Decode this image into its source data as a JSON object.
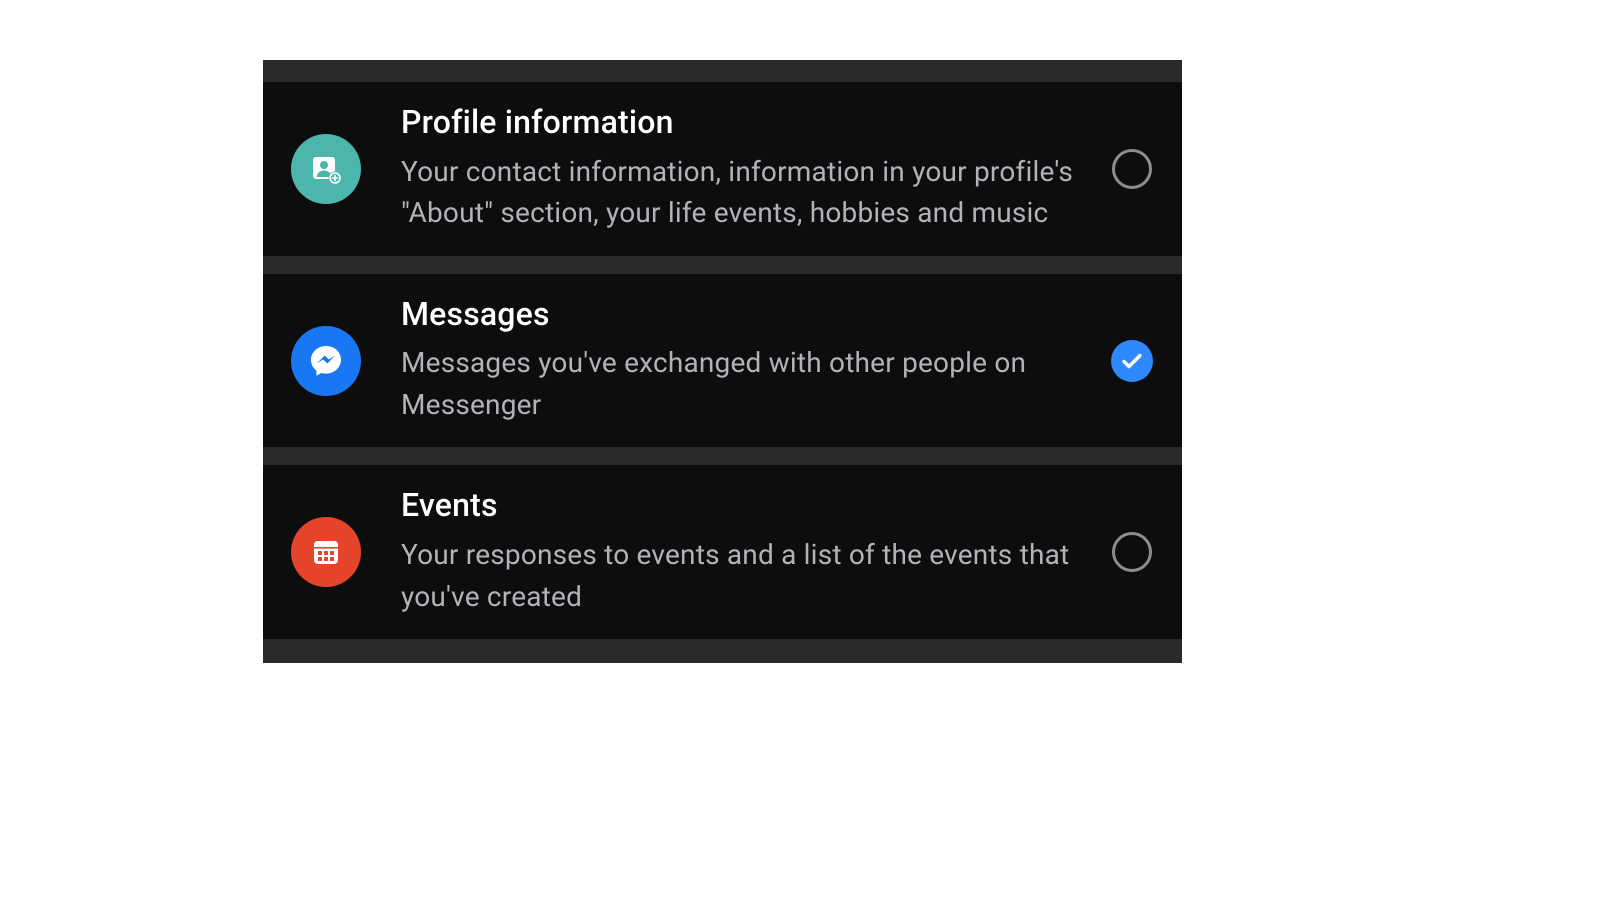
{
  "colors": {
    "accent_blue": "#1877F2",
    "accent_teal": "#4db6ac",
    "accent_red": "#E4442A",
    "check_blue": "#2e89ff",
    "panel_bg": "#0d0d0d",
    "divider_bg": "#2a2a2a",
    "text_primary": "#ffffff",
    "text_secondary": "#b0b3b8"
  },
  "rows": [
    {
      "id": "profile-information",
      "icon": "profile-card-icon",
      "title": "Profile information",
      "description": "Your contact information, information in your profile's \"About\" section, your life events, hobbies and music",
      "selected": false
    },
    {
      "id": "messages",
      "icon": "messenger-icon",
      "title": "Messages",
      "description": "Messages you've exchanged with other people on Messenger",
      "selected": true
    },
    {
      "id": "events",
      "icon": "calendar-icon",
      "title": "Events",
      "description": "Your responses to events and a list of the events that you've created",
      "selected": false
    }
  ]
}
